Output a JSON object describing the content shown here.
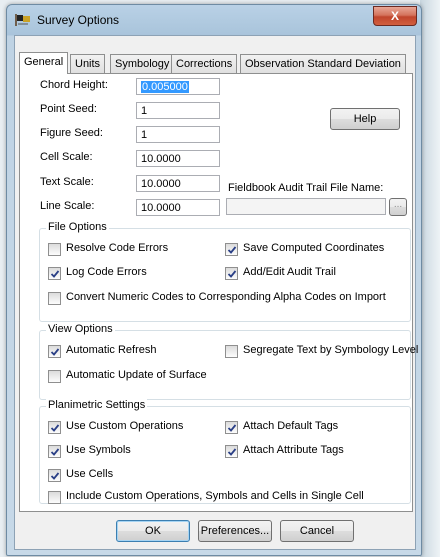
{
  "window": {
    "title": "Survey Options",
    "close_label": "X"
  },
  "tabs": [
    {
      "label": "General",
      "active": true
    },
    {
      "label": "Units",
      "active": false
    },
    {
      "label": "Symbology",
      "active": false
    },
    {
      "label": "Corrections",
      "active": false
    },
    {
      "label": "Observation Standard Deviation",
      "active": false
    }
  ],
  "fields": {
    "chord_height": {
      "label": "Chord Height:",
      "value": "0.005000"
    },
    "point_seed": {
      "label": "Point Seed:",
      "value": "1"
    },
    "figure_seed": {
      "label": "Figure Seed:",
      "value": "1"
    },
    "cell_scale": {
      "label": "Cell Scale:",
      "value": "10.0000"
    },
    "text_scale": {
      "label": "Text Scale:",
      "value": "10.0000"
    },
    "line_scale": {
      "label": "Line Scale:",
      "value": "10.0000"
    },
    "fieldbook": {
      "label": "Fieldbook Audit Trail File Name:",
      "value": "",
      "browse": "..."
    }
  },
  "help_button": "Help",
  "file_options": {
    "title": "File Options",
    "resolve_code_errors": {
      "label": "Resolve Code Errors",
      "checked": false
    },
    "save_computed_coordinates": {
      "label": "Save Computed Coordinates",
      "checked": true
    },
    "log_code_errors": {
      "label": "Log Code Errors",
      "checked": true
    },
    "add_edit_audit_trail": {
      "label": "Add/Edit Audit Trail",
      "checked": true
    },
    "convert_numeric_codes": {
      "label": "Convert Numeric Codes to Corresponding Alpha Codes on Import",
      "checked": false
    }
  },
  "view_options": {
    "title": "View Options",
    "automatic_refresh": {
      "label": "Automatic Refresh",
      "checked": true
    },
    "segregate_text": {
      "label": "Segregate Text by Symbology Level",
      "checked": false
    },
    "automatic_update_surface": {
      "label": "Automatic Update of Surface",
      "checked": false
    }
  },
  "planimetric_settings": {
    "title": "Planimetric Settings",
    "use_custom_operations": {
      "label": "Use Custom Operations",
      "checked": true
    },
    "attach_default_tags": {
      "label": "Attach Default Tags",
      "checked": true
    },
    "use_symbols": {
      "label": "Use Symbols",
      "checked": true
    },
    "attach_attribute_tags": {
      "label": "Attach Attribute Tags",
      "checked": true
    },
    "use_cells": {
      "label": "Use Cells",
      "checked": true
    },
    "include_single_cell": {
      "label": "Include Custom Operations, Symbols and Cells in Single Cell",
      "checked": false
    }
  },
  "footer": {
    "ok": "OK",
    "preferences": "Preferences...",
    "cancel": "Cancel"
  },
  "icons": {
    "app": "survey-flag-icon",
    "check": "checkmark-icon"
  }
}
